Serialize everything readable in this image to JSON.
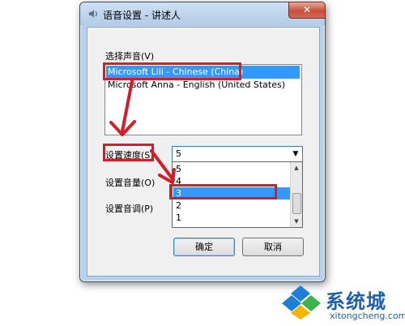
{
  "window": {
    "title": "语音设置 - 讲述人",
    "close_label": "✕"
  },
  "voice": {
    "label": "选择声音(V)",
    "items": [
      {
        "label": "Microsoft Lili - Chinese (China)",
        "selected": true
      },
      {
        "label": "Microsoft Anna - English (United States)",
        "selected": false
      }
    ]
  },
  "speed": {
    "label": "设置速度(S)",
    "value": "5",
    "options": [
      "5",
      "4",
      "3",
      "2",
      "1"
    ],
    "highlighted": "3"
  },
  "volume": {
    "label": "设置音量(O)"
  },
  "pitch": {
    "label": "设置音调(P)"
  },
  "buttons": {
    "ok": "确定",
    "cancel": "取消"
  },
  "watermark": {
    "brand": "系统城",
    "url": "xitongcheng.com"
  },
  "colors": {
    "selection": "#3399ff",
    "annotation": "#d01f2a",
    "watermark": "#1e5fae"
  },
  "icons": {
    "app": "narrator-speaker-icon",
    "close": "close-icon",
    "dropdown": "chevron-down-icon",
    "logo": "windows-logo-icon"
  }
}
